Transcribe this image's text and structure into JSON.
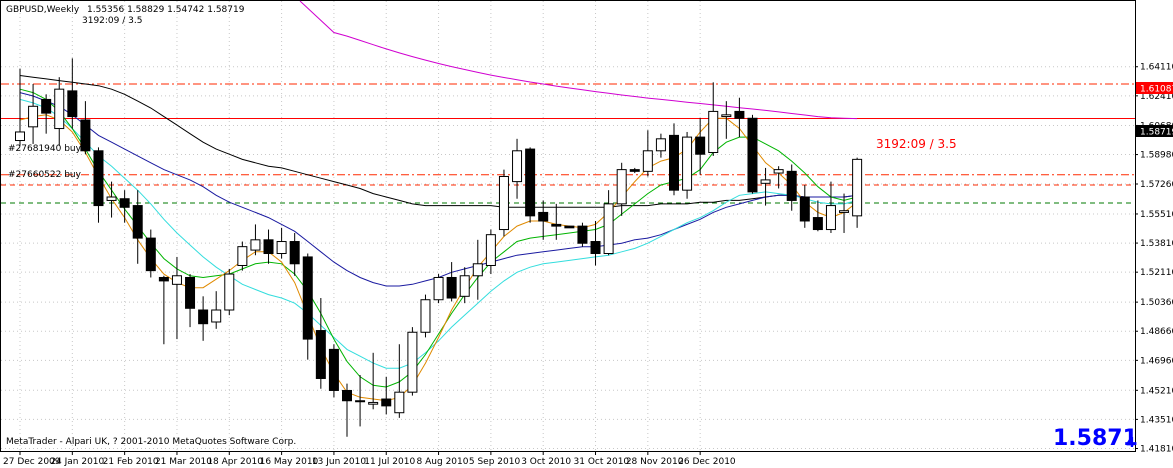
{
  "header": {
    "symbol": "GBPUSD,Weekly",
    "ohlc": "1.55356 1.58829 1.54742 1.58719",
    "sub": "3192:09 / 3.5"
  },
  "footer": {
    "copyright": "MetaTrader - Alpari UK, ? 2001-2010 MetaQuotes Software Corp."
  },
  "current_price": {
    "main": "1.5871",
    "sub": "4",
    "box": "1.58719"
  },
  "line_labels": {
    "red_line": "1.61087"
  },
  "annotations": {
    "timer": "3192:09 / 3.5"
  },
  "order_labels": [
    "#27681940 buy",
    "#27660522 buy"
  ],
  "colors": {
    "background": "#ffffff",
    "grid": "#c8c8c8",
    "candle": "#000000",
    "ma_black": "#000000",
    "ma_navy": "#1a1aa0",
    "ma_cyan": "#33dddd",
    "ma_green": "#00b400",
    "ma_orange": "#e08a00",
    "ma_magenta": "#d000d0",
    "level_red": "#ff0000",
    "order_dashed_red": "#ff2a00",
    "order_dashed_green": "#007a00",
    "price_text": "#0000ff"
  },
  "chart_data": {
    "type": "candlestick",
    "title": "GBPUSD,Weekly",
    "ylim": [
      1.4181,
      1.6611
    ],
    "y_ticks": [
      "1.64110",
      "1.62410",
      "1.60680",
      "1.58980",
      "1.57260",
      "1.55510",
      "1.53810",
      "1.52110",
      "1.50360",
      "1.48660",
      "1.46960",
      "1.45210",
      "1.43510",
      "1.41810"
    ],
    "x_tick_labels": [
      "27 Dec 2009",
      "24 Jan 2010",
      "21 Feb 2010",
      "21 Mar 2010",
      "18 Apr 2010",
      "16 May 2010",
      "13 Jun 2010",
      "11 Jul 2010",
      "8 Aug 2010",
      "5 Sep 2010",
      "3 Oct 2010",
      "31 Oct 2010",
      "28 Nov 2010",
      "26 Dec 2010"
    ],
    "grid": true,
    "candles": [
      {
        "o": 1.598,
        "h": 1.64,
        "l": 1.595,
        "c": 1.603
      },
      {
        "o": 1.606,
        "h": 1.631,
        "l": 1.596,
        "c": 1.618
      },
      {
        "o": 1.622,
        "h": 1.625,
        "l": 1.602,
        "c": 1.614
      },
      {
        "o": 1.605,
        "h": 1.635,
        "l": 1.595,
        "c": 1.628
      },
      {
        "o": 1.627,
        "h": 1.646,
        "l": 1.605,
        "c": 1.612
      },
      {
        "o": 1.61,
        "h": 1.621,
        "l": 1.59,
        "c": 1.592
      },
      {
        "o": 1.592,
        "h": 1.594,
        "l": 1.55,
        "c": 1.56
      },
      {
        "o": 1.563,
        "h": 1.574,
        "l": 1.553,
        "c": 1.565
      },
      {
        "o": 1.564,
        "h": 1.569,
        "l": 1.55,
        "c": 1.559
      },
      {
        "o": 1.56,
        "h": 1.569,
        "l": 1.526,
        "c": 1.541
      },
      {
        "o": 1.541,
        "h": 1.546,
        "l": 1.518,
        "c": 1.522
      },
      {
        "o": 1.518,
        "h": 1.519,
        "l": 1.479,
        "c": 1.516
      },
      {
        "o": 1.514,
        "h": 1.53,
        "l": 1.482,
        "c": 1.519
      },
      {
        "o": 1.518,
        "h": 1.52,
        "l": 1.489,
        "c": 1.5
      },
      {
        "o": 1.499,
        "h": 1.507,
        "l": 1.481,
        "c": 1.491
      },
      {
        "o": 1.492,
        "h": 1.51,
        "l": 1.488,
        "c": 1.499
      },
      {
        "o": 1.499,
        "h": 1.523,
        "l": 1.496,
        "c": 1.52
      },
      {
        "o": 1.525,
        "h": 1.539,
        "l": 1.522,
        "c": 1.536
      },
      {
        "o": 1.534,
        "h": 1.549,
        "l": 1.531,
        "c": 1.54
      },
      {
        "o": 1.54,
        "h": 1.546,
        "l": 1.526,
        "c": 1.532
      },
      {
        "o": 1.532,
        "h": 1.547,
        "l": 1.529,
        "c": 1.539
      },
      {
        "o": 1.539,
        "h": 1.544,
        "l": 1.519,
        "c": 1.526
      },
      {
        "o": 1.53,
        "h": 1.532,
        "l": 1.47,
        "c": 1.482
      },
      {
        "o": 1.487,
        "h": 1.506,
        "l": 1.453,
        "c": 1.459
      },
      {
        "o": 1.476,
        "h": 1.479,
        "l": 1.448,
        "c": 1.452
      },
      {
        "o": 1.452,
        "h": 1.456,
        "l": 1.425,
        "c": 1.446
      },
      {
        "o": 1.446,
        "h": 1.461,
        "l": 1.431,
        "c": 1.446
      },
      {
        "o": 1.444,
        "h": 1.474,
        "l": 1.441,
        "c": 1.445
      },
      {
        "o": 1.447,
        "h": 1.46,
        "l": 1.438,
        "c": 1.443
      },
      {
        "o": 1.439,
        "h": 1.479,
        "l": 1.436,
        "c": 1.451
      },
      {
        "o": 1.451,
        "h": 1.489,
        "l": 1.449,
        "c": 1.486
      },
      {
        "o": 1.486,
        "h": 1.508,
        "l": 1.483,
        "c": 1.505
      },
      {
        "o": 1.505,
        "h": 1.52,
        "l": 1.503,
        "c": 1.518
      },
      {
        "o": 1.518,
        "h": 1.527,
        "l": 1.504,
        "c": 1.506
      },
      {
        "o": 1.507,
        "h": 1.524,
        "l": 1.503,
        "c": 1.519
      },
      {
        "o": 1.519,
        "h": 1.54,
        "l": 1.505,
        "c": 1.526
      },
      {
        "o": 1.525,
        "h": 1.546,
        "l": 1.52,
        "c": 1.543
      },
      {
        "o": 1.546,
        "h": 1.581,
        "l": 1.542,
        "c": 1.577
      },
      {
        "o": 1.574,
        "h": 1.599,
        "l": 1.564,
        "c": 1.592
      },
      {
        "o": 1.593,
        "h": 1.594,
        "l": 1.55,
        "c": 1.554
      },
      {
        "o": 1.556,
        "h": 1.563,
        "l": 1.54,
        "c": 1.551
      },
      {
        "o": 1.549,
        "h": 1.561,
        "l": 1.54,
        "c": 1.548
      },
      {
        "o": 1.548,
        "h": 1.548,
        "l": 1.548,
        "c": 1.547
      },
      {
        "o": 1.548,
        "h": 1.55,
        "l": 1.536,
        "c": 1.538
      },
      {
        "o": 1.539,
        "h": 1.551,
        "l": 1.525,
        "c": 1.532
      },
      {
        "o": 1.532,
        "h": 1.569,
        "l": 1.531,
        "c": 1.561
      },
      {
        "o": 1.561,
        "h": 1.585,
        "l": 1.554,
        "c": 1.581
      },
      {
        "o": 1.581,
        "h": 1.582,
        "l": 1.579,
        "c": 1.58
      },
      {
        "o": 1.58,
        "h": 1.604,
        "l": 1.577,
        "c": 1.592
      },
      {
        "o": 1.592,
        "h": 1.602,
        "l": 1.588,
        "c": 1.599
      },
      {
        "o": 1.601,
        "h": 1.608,
        "l": 1.566,
        "c": 1.569
      },
      {
        "o": 1.569,
        "h": 1.603,
        "l": 1.564,
        "c": 1.6
      },
      {
        "o": 1.6,
        "h": 1.611,
        "l": 1.578,
        "c": 1.59
      },
      {
        "o": 1.591,
        "h": 1.632,
        "l": 1.589,
        "c": 1.615
      },
      {
        "o": 1.612,
        "h": 1.621,
        "l": 1.599,
        "c": 1.613
      },
      {
        "o": 1.615,
        "h": 1.623,
        "l": 1.6,
        "c": 1.611
      },
      {
        "o": 1.611,
        "h": 1.613,
        "l": 1.567,
        "c": 1.568
      },
      {
        "o": 1.573,
        "h": 1.582,
        "l": 1.56,
        "c": 1.575
      },
      {
        "o": 1.579,
        "h": 1.583,
        "l": 1.57,
        "c": 1.581
      },
      {
        "o": 1.58,
        "h": 1.584,
        "l": 1.557,
        "c": 1.563
      },
      {
        "o": 1.565,
        "h": 1.572,
        "l": 1.547,
        "c": 1.551
      },
      {
        "o": 1.553,
        "h": 1.563,
        "l": 1.545,
        "c": 1.546
      },
      {
        "o": 1.546,
        "h": 1.574,
        "l": 1.544,
        "c": 1.56
      },
      {
        "o": 1.556,
        "h": 1.567,
        "l": 1.544,
        "c": 1.557
      },
      {
        "o": 1.554,
        "h": 1.588,
        "l": 1.547,
        "c": 1.587
      }
    ],
    "moving_averages": [
      {
        "name": "black",
        "color": "#000000",
        "values": [
          1.636,
          1.635,
          1.634,
          1.633,
          1.632,
          1.631,
          1.63,
          1.628,
          1.625,
          1.621,
          1.617,
          1.612,
          1.607,
          1.602,
          1.597,
          1.593,
          1.59,
          1.587,
          1.585,
          1.583,
          1.582,
          1.58,
          1.578,
          1.576,
          1.574,
          1.572,
          1.57,
          1.567,
          1.565,
          1.563,
          1.561,
          1.56,
          1.56,
          1.56,
          1.56,
          1.56,
          1.56,
          1.559,
          1.559,
          1.559,
          1.559,
          1.559,
          1.559,
          1.559,
          1.559,
          1.559,
          1.56,
          1.56,
          1.56,
          1.561,
          1.561,
          1.561,
          1.562,
          1.562,
          1.563,
          1.563,
          1.564,
          1.565,
          1.566,
          1.566,
          1.565,
          1.565,
          1.565,
          1.565,
          1.566
        ]
      },
      {
        "name": "navy",
        "color": "#1a1aa0",
        "values": [
          1.626,
          1.624,
          1.621,
          1.618,
          1.613,
          1.607,
          1.601,
          1.597,
          1.593,
          1.589,
          1.585,
          1.581,
          1.578,
          1.575,
          1.571,
          1.566,
          1.562,
          1.559,
          1.556,
          1.553,
          1.549,
          1.545,
          1.539,
          1.533,
          1.527,
          1.522,
          1.518,
          1.515,
          1.513,
          1.513,
          1.514,
          1.516,
          1.518,
          1.521,
          1.523,
          1.525,
          1.527,
          1.529,
          1.531,
          1.532,
          1.533,
          1.534,
          1.535,
          1.536,
          1.536,
          1.537,
          1.538,
          1.54,
          1.541,
          1.543,
          1.546,
          1.549,
          1.552,
          1.556,
          1.559,
          1.561,
          1.563,
          1.565,
          1.566,
          1.566,
          1.565,
          1.565,
          1.565,
          1.565,
          1.566
        ]
      },
      {
        "name": "cyan",
        "color": "#33dddd",
        "values": [
          1.622,
          1.62,
          1.617,
          1.612,
          1.605,
          1.597,
          1.589,
          1.583,
          1.576,
          1.569,
          1.561,
          1.552,
          1.544,
          1.537,
          1.53,
          1.524,
          1.519,
          1.514,
          1.511,
          1.508,
          1.506,
          1.503,
          1.497,
          1.49,
          1.483,
          1.476,
          1.472,
          1.468,
          1.465,
          1.465,
          1.468,
          1.474,
          1.481,
          1.489,
          1.496,
          1.503,
          1.51,
          1.516,
          1.521,
          1.524,
          1.526,
          1.527,
          1.528,
          1.529,
          1.53,
          1.531,
          1.533,
          1.535,
          1.538,
          1.542,
          1.546,
          1.55,
          1.553,
          1.557,
          1.562,
          1.566,
          1.567,
          1.568,
          1.567,
          1.566,
          1.564,
          1.562,
          1.561,
          1.561,
          1.563
        ]
      },
      {
        "name": "green",
        "color": "#00b400",
        "values": [
          1.628,
          1.626,
          1.622,
          1.615,
          1.605,
          1.593,
          1.58,
          1.569,
          1.558,
          1.548,
          1.538,
          1.529,
          1.523,
          1.519,
          1.518,
          1.519,
          1.52,
          1.523,
          1.526,
          1.527,
          1.526,
          1.52,
          1.51,
          1.497,
          1.482,
          1.469,
          1.46,
          1.455,
          1.454,
          1.457,
          1.463,
          1.473,
          1.485,
          1.497,
          1.508,
          1.518,
          1.527,
          1.533,
          1.539,
          1.541,
          1.542,
          1.543,
          1.544,
          1.545,
          1.546,
          1.549,
          1.555,
          1.561,
          1.567,
          1.572,
          1.574,
          1.576,
          1.581,
          1.591,
          1.597,
          1.6,
          1.6,
          1.596,
          1.592,
          1.586,
          1.579,
          1.571,
          1.565,
          1.563,
          1.565
        ]
      },
      {
        "name": "orange",
        "color": "#e08a00",
        "values": [
          1.61,
          1.612,
          1.613,
          1.61,
          1.603,
          1.591,
          1.577,
          1.564,
          1.553,
          1.54,
          1.529,
          1.52,
          1.515,
          1.512,
          1.512,
          1.517,
          1.522,
          1.528,
          1.533,
          1.533,
          1.527,
          1.515,
          1.496,
          1.477,
          1.462,
          1.451,
          1.448,
          1.447,
          1.446,
          1.448,
          1.455,
          1.468,
          1.483,
          1.499,
          1.512,
          1.524,
          1.533,
          1.542,
          1.548,
          1.551,
          1.551,
          1.549,
          1.548,
          1.547,
          1.549,
          1.556,
          1.565,
          1.574,
          1.582,
          1.586,
          1.588,
          1.593,
          1.603,
          1.611,
          1.611,
          1.605,
          1.595,
          1.585,
          1.579,
          1.572,
          1.562,
          1.556,
          1.553,
          1.556,
          1.562
        ]
      },
      {
        "name": "magenta",
        "color": "#d000d0",
        "values": [
          null,
          null,
          null,
          null,
          null,
          null,
          null,
          null,
          null,
          null,
          null,
          null,
          null,
          null,
          null,
          null,
          null,
          null,
          null,
          null,
          null,
          null,
          null,
          null,
          1.6611,
          1.659,
          1.6565,
          1.654,
          1.6515,
          1.6492,
          1.647,
          1.645,
          1.643,
          1.6412,
          1.6395,
          1.6378,
          1.6362,
          1.6348,
          1.6335,
          1.6322,
          1.631,
          1.6298,
          1.6287,
          1.6276,
          1.6266,
          1.6256,
          1.6246,
          1.6237,
          1.6228,
          1.622,
          1.6212,
          1.6204,
          1.6196,
          1.6188,
          1.618,
          1.6172,
          1.6164,
          1.6156,
          1.6147,
          1.6138,
          1.6129,
          1.612,
          1.6113,
          1.611,
          1.6108
        ]
      }
    ],
    "horizontal_lines": [
      {
        "price": 1.61087,
        "style": "solid",
        "color": "#ff0000"
      },
      {
        "price": 1.631,
        "style": "dashdot",
        "color": "#ff2a00"
      },
      {
        "price": 1.578,
        "style": "dashdot",
        "color": "#ff2a00"
      },
      {
        "price": 1.572,
        "style": "dashed",
        "color": "#ff2a00"
      },
      {
        "price": 1.5615,
        "style": "dashed",
        "color": "#007a00"
      }
    ]
  }
}
